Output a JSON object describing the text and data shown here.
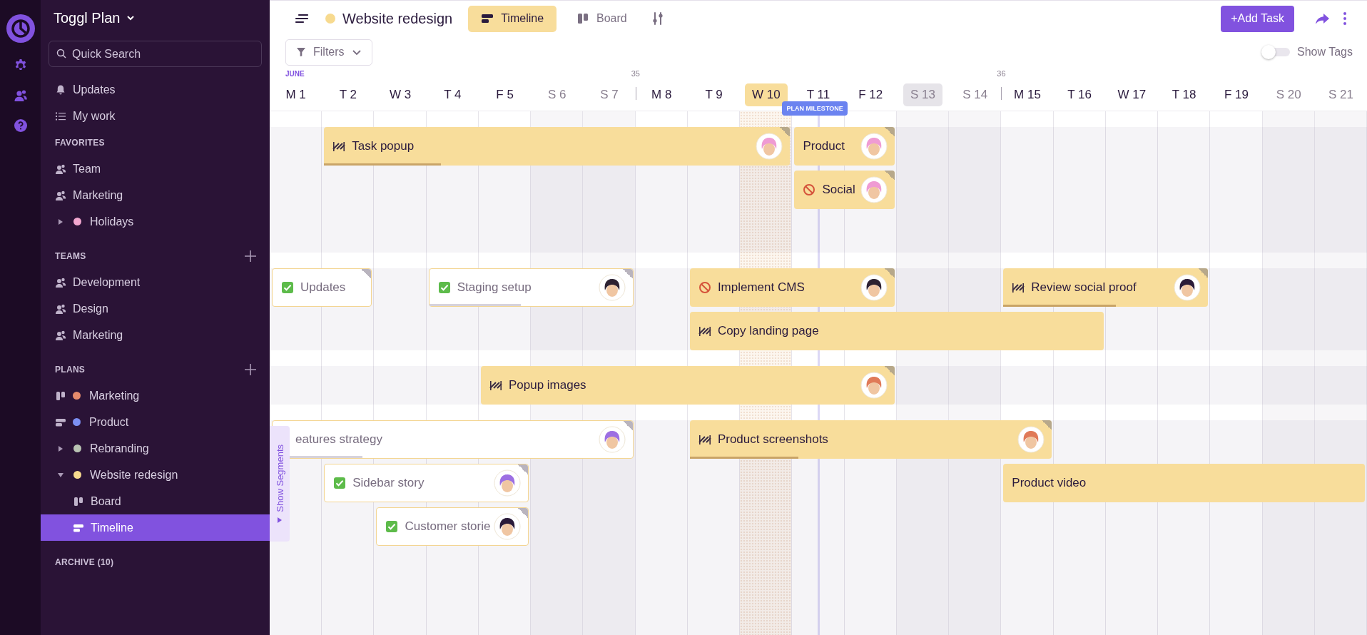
{
  "app": {
    "name": "Toggl Plan"
  },
  "sidebar": {
    "search": {
      "placeholder": "Quick Search"
    },
    "nav": [
      {
        "label": "Updates",
        "kind": "notifications",
        "selected": false
      },
      {
        "label": "My work",
        "kind": "tasks",
        "selected": false
      }
    ],
    "sections": [
      {
        "heading": "FAVORITES",
        "can_add": false,
        "items": [
          {
            "label": "Team",
            "kind": "team",
            "selected": false
          },
          {
            "label": "Marketing",
            "kind": "team",
            "selected": false
          },
          {
            "label": "Holidays",
            "kind": "plan",
            "color": "#f2a7cf",
            "expanded": false,
            "selected": false
          }
        ]
      },
      {
        "heading": "TEAMS",
        "can_add": true,
        "items": [
          {
            "label": "Development",
            "kind": "team",
            "selected": false
          },
          {
            "label": "Design",
            "kind": "team",
            "selected": false
          },
          {
            "label": "Marketing",
            "kind": "team",
            "selected": false
          }
        ]
      },
      {
        "heading": "PLANS",
        "can_add": true,
        "items": [
          {
            "label": "Marketing",
            "kind": "board",
            "color": "#e58a6c",
            "selected": false
          },
          {
            "label": "Product",
            "kind": "timeline",
            "color": "#7c8ff2",
            "selected": false
          },
          {
            "label": "Rebranding",
            "kind": "plan",
            "color": "#b9c3b3",
            "expanded": false,
            "selected": false
          },
          {
            "label": "Website redesign",
            "kind": "plan",
            "color": "#f7da8f",
            "expanded": true,
            "selected": false,
            "children": [
              {
                "label": "Board",
                "kind": "board",
                "selected": false
              },
              {
                "label": "Timeline",
                "kind": "timeline",
                "selected": true
              }
            ]
          }
        ]
      }
    ],
    "archive": "ARCHIVE (10)"
  },
  "header": {
    "plan": {
      "title": "Website redesign",
      "color": "#f7da8f"
    },
    "tabs": [
      {
        "label": "Timeline",
        "kind": "timeline",
        "selected": true
      },
      {
        "label": "Board",
        "kind": "board",
        "selected": false
      }
    ],
    "add_button": "+Add Task",
    "filters": "Filters",
    "show_tags": {
      "label": "Show Tags",
      "on": false
    }
  },
  "timeline": {
    "month": "JUNE",
    "days": [
      {
        "label": "M 1",
        "weekend": false,
        "today": false,
        "highlighted": false
      },
      {
        "label": "T 2",
        "weekend": false,
        "today": false,
        "highlighted": false
      },
      {
        "label": "W 3",
        "weekend": false,
        "today": false,
        "highlighted": false
      },
      {
        "label": "T 4",
        "weekend": false,
        "today": false,
        "highlighted": false
      },
      {
        "label": "F 5",
        "weekend": false,
        "today": false,
        "highlighted": false
      },
      {
        "label": "S 6",
        "weekend": true,
        "today": false,
        "highlighted": false
      },
      {
        "label": "S 7",
        "weekend": true,
        "today": false,
        "highlighted": false
      },
      {
        "label": "M 8",
        "weekend": false,
        "today": false,
        "highlighted": false,
        "week": "35"
      },
      {
        "label": "T 9",
        "weekend": false,
        "today": false,
        "highlighted": false
      },
      {
        "label": "W 10",
        "weekend": false,
        "today": true,
        "highlighted": false
      },
      {
        "label": "T 11",
        "weekend": false,
        "today": false,
        "highlighted": false,
        "milestone": "PLAN MILESTONE"
      },
      {
        "label": "F 12",
        "weekend": false,
        "today": false,
        "highlighted": false
      },
      {
        "label": "S 13",
        "weekend": true,
        "today": false,
        "highlighted": true
      },
      {
        "label": "S 14",
        "weekend": true,
        "today": false,
        "highlighted": false
      },
      {
        "label": "M 15",
        "weekend": false,
        "today": false,
        "highlighted": false,
        "week": "36"
      },
      {
        "label": "T 16",
        "weekend": false,
        "today": false,
        "highlighted": false
      },
      {
        "label": "W 17",
        "weekend": false,
        "today": false,
        "highlighted": false
      },
      {
        "label": "T 18",
        "weekend": false,
        "today": false,
        "highlighted": false
      },
      {
        "label": "F 19",
        "weekend": false,
        "today": false,
        "highlighted": false
      },
      {
        "label": "S 20",
        "weekend": true,
        "today": false,
        "highlighted": false
      },
      {
        "label": "S 21",
        "weekend": true,
        "today": false,
        "highlighted": false
      }
    ],
    "show_segments": "Show Segments",
    "segments": [
      {
        "rows": [
          [
            "",
            {
              "title": "Task popup",
              "done": false,
              "kind": "in_progress",
              "corner": true,
              "avatar": {
                "color": "#ef9bd3"
              },
              "level": 0.25
            },
            null,
            null,
            null,
            null,
            null,
            null,
            null,
            null,
            {
              "title": "Product",
              "done": false,
              "corner": true,
              "avatar": {
                "color": "#ef9bd3"
              }
            },
            null
          ],
          [
            "",
            "",
            "",
            "",
            "",
            "",
            "",
            "",
            "",
            "",
            {
              "title": "Social",
              "done": false,
              "kind": "blocked",
              "corner": true,
              "avatar": {
                "color": "#ef9bd3"
              }
            },
            null
          ],
          []
        ]
      },
      {
        "rows": [
          [
            {
              "title": "Updates",
              "done": true,
              "kind": "done",
              "corner": true
            },
            null,
            "",
            {
              "title": "Staging setup",
              "done": true,
              "kind": "done",
              "corner": true,
              "avatar": {
                "color": "#2d2131"
              },
              "level": 0.45
            },
            null,
            null,
            null,
            "",
            {
              "title": "Implement CMS",
              "done": false,
              "kind": "blocked",
              "corner": true,
              "avatar": {
                "color": "#2d2131"
              }
            },
            null,
            null,
            null,
            "",
            "",
            {
              "title": "Review social proof",
              "done": false,
              "kind": "in_progress",
              "corner": true,
              "avatar": {
                "color": "#2a1a38"
              },
              "level": 0.55
            },
            null,
            null,
            null
          ],
          [
            "",
            "",
            "",
            "",
            "",
            "",
            "",
            "",
            {
              "title": "Copy landing page",
              "done": false,
              "kind": "in_progress",
              "corner": false
            },
            null,
            null,
            null,
            null,
            null,
            null,
            null
          ]
        ]
      },
      {
        "rows": [
          [
            "",
            "",
            "",
            "",
            {
              "title": "Popup images",
              "done": false,
              "kind": "in_progress",
              "corner": true,
              "avatar": {
                "color": "#e07a58"
              }
            },
            null,
            null,
            null,
            null,
            null,
            null,
            null
          ]
        ]
      },
      {
        "rows": [
          [
            {
              "title": "eatures strategy",
              "done": true,
              "corner": true,
              "avatar": {
                "color": "#9d6fe2"
              },
              "level": 0.25
            },
            null,
            null,
            null,
            null,
            null,
            null,
            "",
            {
              "title": "Product screenshots",
              "done": false,
              "kind": "in_progress",
              "corner": true,
              "avatar": {
                "color": "#e07a58"
              },
              "level": 0.3
            },
            null,
            null,
            null,
            null,
            null,
            null
          ],
          [
            "",
            {
              "title": "Sidebar story",
              "done": true,
              "kind": "done",
              "corner": true,
              "avatar": {
                "color": "#9d6fe2"
              }
            },
            null,
            null,
            null,
            "",
            "",
            "",
            "",
            "",
            "",
            "",
            "",
            "",
            {
              "title": "Product video",
              "done": false,
              "corner": false
            },
            null,
            null,
            null,
            null,
            null,
            null
          ],
          [
            "",
            "",
            {
              "title": "Customer storie",
              "done": true,
              "kind": "done",
              "corner": true,
              "avatar": {
                "color": "#2a1a38"
              }
            },
            null,
            null
          ]
        ]
      }
    ]
  }
}
